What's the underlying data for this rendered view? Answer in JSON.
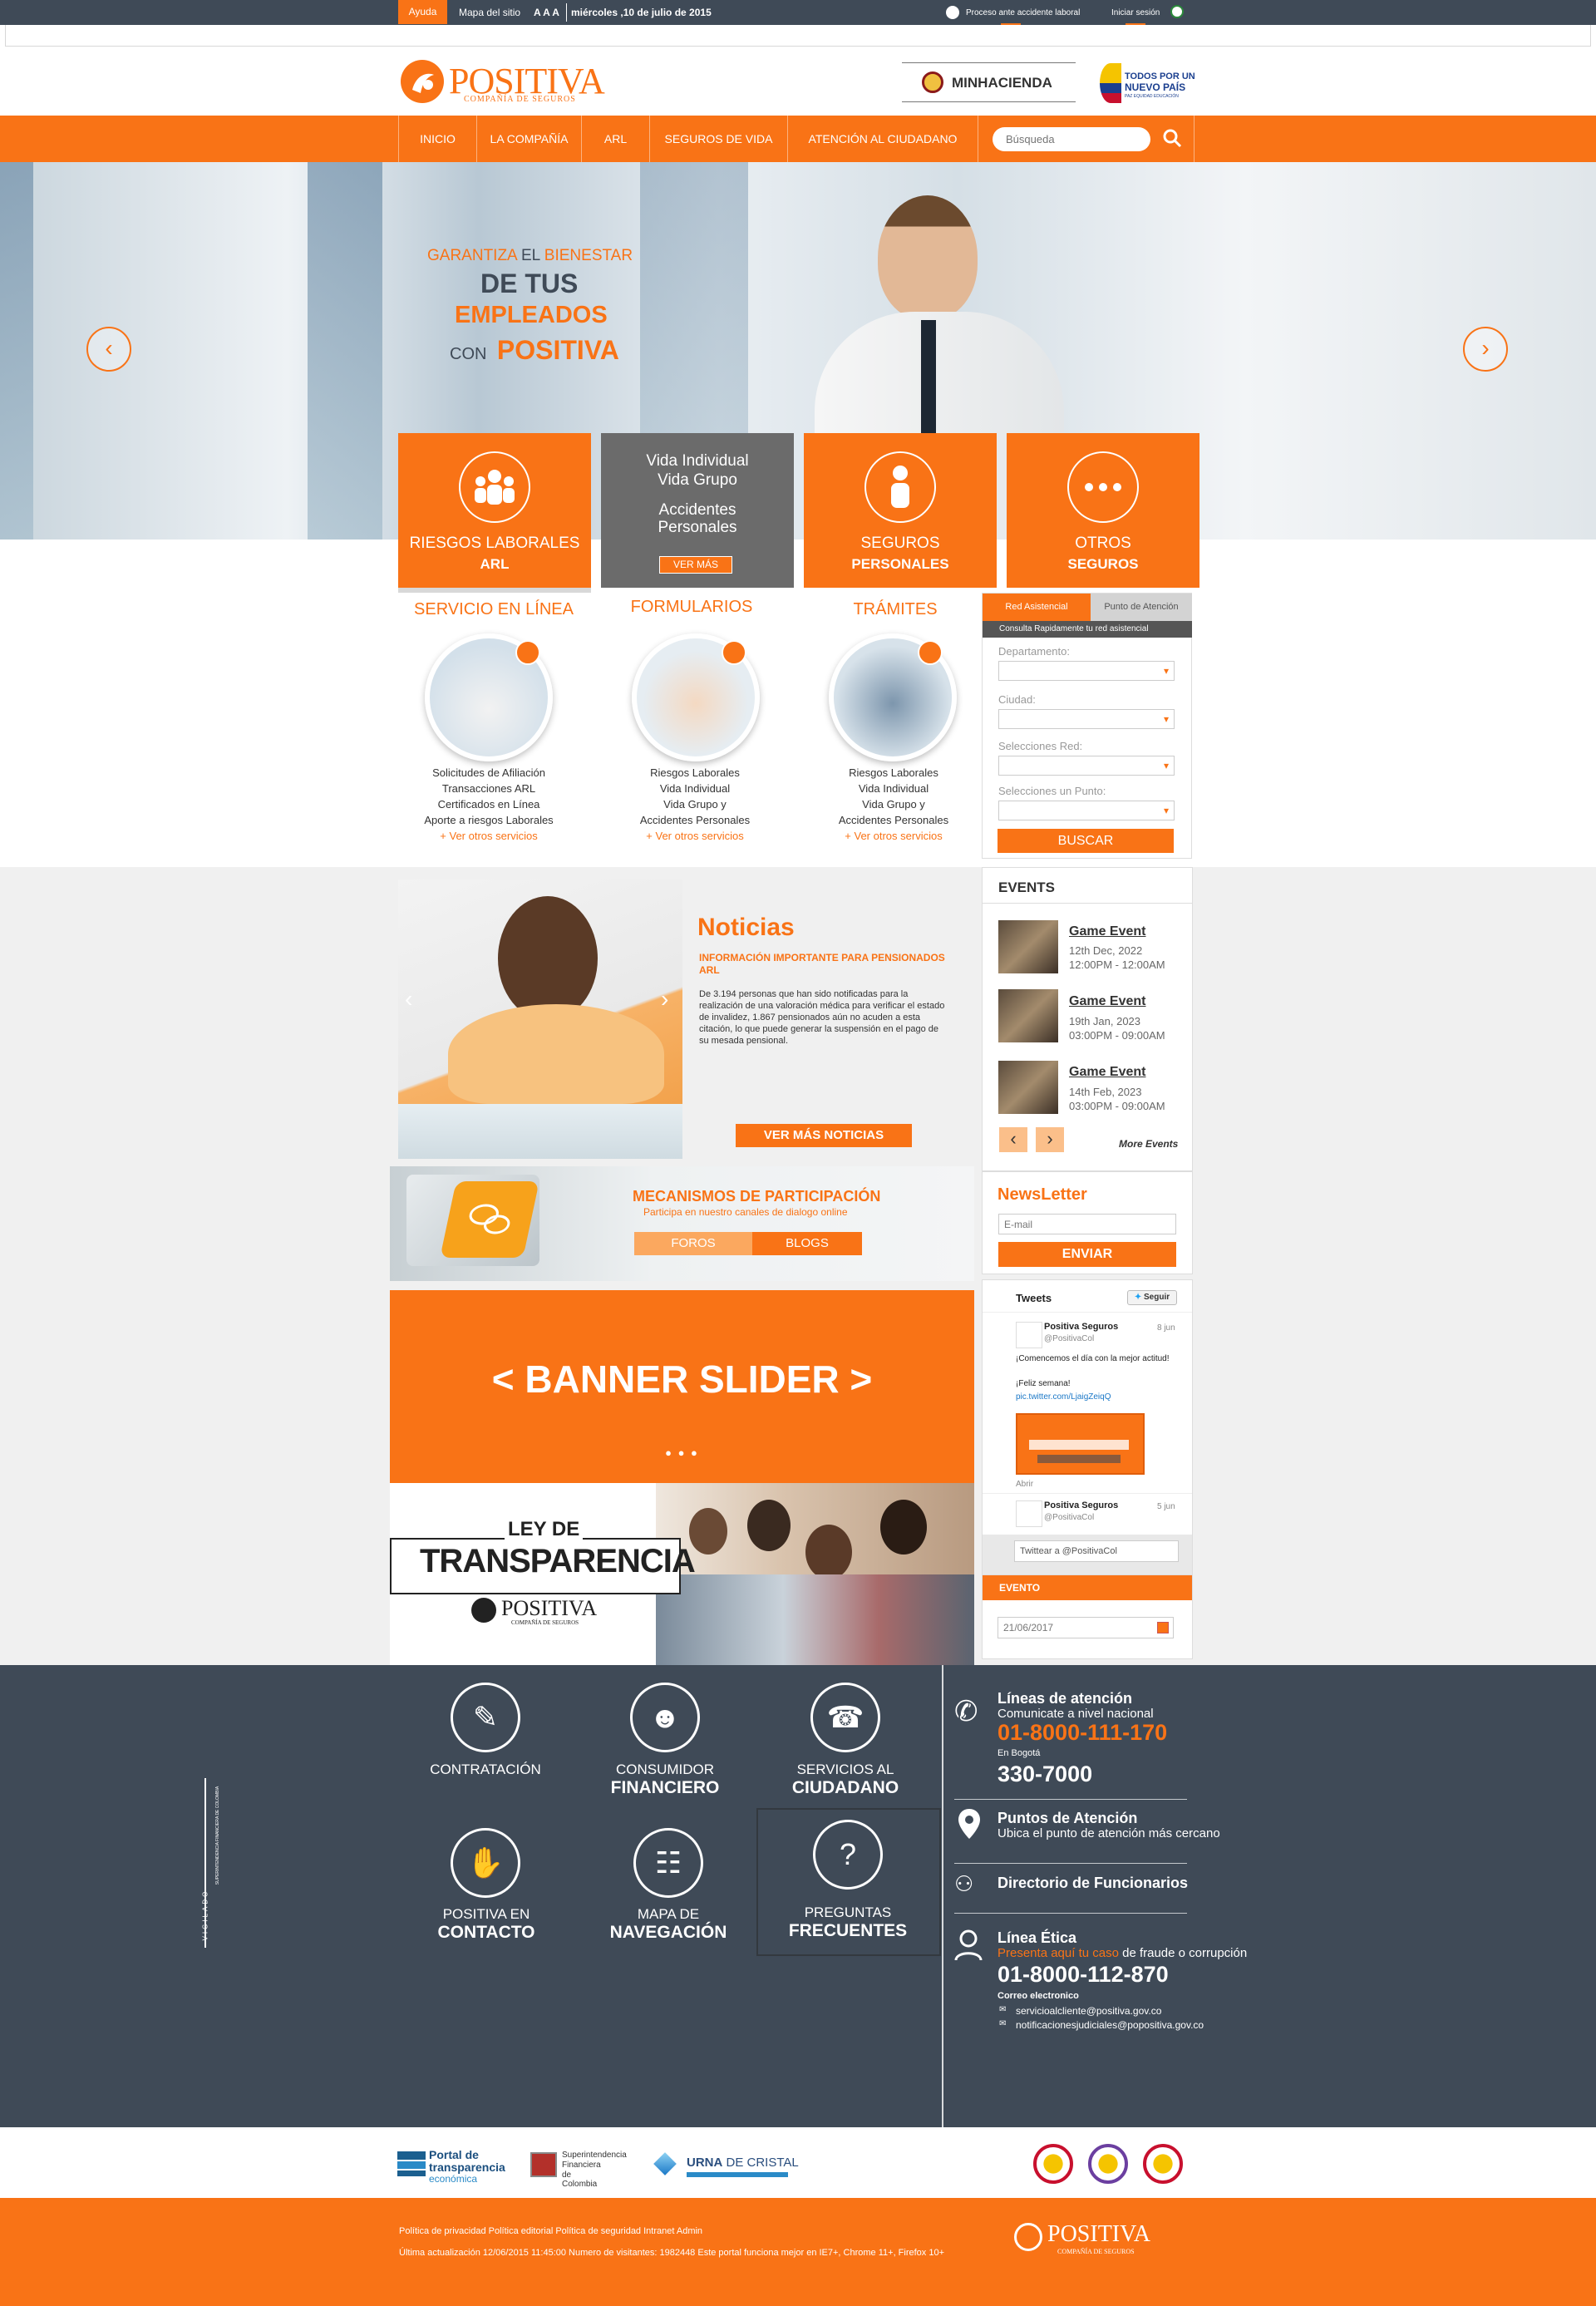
{
  "topbar": {
    "help": "Ayuda",
    "sitemap": "Mapa del sitio",
    "font_size": "A A A",
    "date": "miércoles ,10 de julio de 2015",
    "accident": "Proceso ante accidente laboral",
    "login": "Iniciar sesión"
  },
  "header": {
    "brand": "POSITIVA",
    "brand_sub": "COMPAÑÍA DE SEGUROS",
    "minhacienda": "MINHACIENDA",
    "gov_line1": "TODOS POR UN",
    "gov_line2": "NUEVO PAÍS",
    "gov_line3": "PAZ  EQUIDAD  EDUCACIÓN"
  },
  "nav": {
    "items": [
      "INICIO",
      "LA COMPAÑÍA",
      "ARL",
      "SEGUROS DE VIDA",
      "ATENCIÓN AL CIUDADANO"
    ],
    "search_placeholder": "Búsqueda"
  },
  "hero": {
    "line1a": "GARANTIZA",
    "line1b": "EL",
    "line1c": "BIENESTAR",
    "line2": "DE TUS",
    "line3": "EMPLEADOS",
    "line4a": "CON",
    "line4b": "POSITIVA"
  },
  "boxes": [
    {
      "l1": "RIESGOS LABORALES",
      "l2": "ARL"
    },
    {
      "l1": "Vida Individual",
      "l2": "Vida Grupo",
      "l3": "Accidentes",
      "l4": "Personales",
      "more": "VER MÁS"
    },
    {
      "l1": "SEGUROS",
      "l2": "PERSONALES"
    },
    {
      "l1": "OTROS",
      "l2": "SEGUROS"
    }
  ],
  "services": [
    {
      "title": "SERVICIO EN LÍNEA",
      "items": [
        "Solicitudes de Afiliación",
        "Transacciones ARL",
        "Certificados en Línea",
        "Aporte a riesgos Laborales"
      ],
      "more": "+ Ver otros servicios"
    },
    {
      "title": "FORMULARIOS",
      "items": [
        "Riesgos Laborales",
        "Vida Individual",
        "Vida Grupo y",
        "Accidentes Personales"
      ],
      "more": "+ Ver otros servicios"
    },
    {
      "title": "TRÁMITES",
      "items": [
        "Riesgos Laborales",
        "Vida Individual",
        "Vida Grupo y",
        "Accidentes Personales"
      ],
      "more": "+ Ver otros servicios"
    }
  ],
  "red_form": {
    "tab1": "Red Asistencial",
    "tab2": "Punto de Atención",
    "subtitle": "Consulta Rapidamente tu red asistencial",
    "fields": [
      "Departamento:",
      "Ciudad:",
      "Selecciones Red:",
      "Selecciones un Punto:"
    ],
    "button": "BUSCAR"
  },
  "news": {
    "title": "Noticias",
    "headline": "INFORMACIÓN IMPORTANTE PARA PENSIONADOS ARL",
    "body": "De 3.194 personas que han sido notificadas para la realización de una valoración médica para verificar el estado de invalidez, 1.867 pensionados aún no acuden a esta citación, lo que puede generar la suspensión en el pago de su mesada pensional.",
    "button": "VER MÁS NOTICIAS"
  },
  "events": {
    "title": "EVENTS",
    "items": [
      {
        "title": "Game Event",
        "date": "12th Dec, 2022",
        "time": "12:00PM - 12:00AM"
      },
      {
        "title": "Game Event",
        "date": "19th Jan, 2023",
        "time": "03:00PM - 09:00AM"
      },
      {
        "title": "Game Event",
        "date": "14th Feb, 2023",
        "time": "03:00PM - 09:00AM"
      }
    ],
    "more": "More Events"
  },
  "participation": {
    "title": "MECANISMOS DE PARTICIPACIÓN",
    "subtitle": "Participa en nuestro canales de dialogo online",
    "tab1": "FOROS",
    "tab2": "BLOGS"
  },
  "newsletter": {
    "title": "NewsLetter",
    "placeholder": "E-mail",
    "button": "ENVIAR"
  },
  "banner": {
    "text": "< BANNER SLIDER >",
    "dots": "● ● ●"
  },
  "tweets": {
    "title": "Tweets",
    "follow": "Seguir",
    "user": "Positiva Seguros",
    "handle": "@PositivaCol",
    "date1": "8 jun",
    "text1": "¡Comencemos el día con la mejor actitud!",
    "text2": "¡Feliz semana!",
    "link": "pic.twitter.com/LjaigZeiqQ",
    "open": "Abrir",
    "date2": "5 jun",
    "compose": "Twittear a @PositivaCol"
  },
  "evento": {
    "title": "EVENTO",
    "date": "21/06/2017"
  },
  "transparency": {
    "line1": "LEY DE",
    "line2": "TRANSPARENCIA"
  },
  "footer": {
    "links": [
      {
        "a": "CONTRATACIÓN",
        "b": ""
      },
      {
        "a": "CONSUMIDOR",
        "b": "FINANCIERO"
      },
      {
        "a": "SERVICIOS AL",
        "b": "CIUDADANO"
      },
      {
        "a": "POSITIVA EN",
        "b": "CONTACTO"
      },
      {
        "a": "MAPA DE",
        "b": "NAVEGACIÓN"
      },
      {
        "a": "PREGUNTAS",
        "b": "FRECUENTES"
      }
    ],
    "vigilado": "VIGILADO",
    "superintendencia": "SUPERINTENDENCIA FINANCIERA DE COLOMBIA",
    "lines_title": "Líneas de atención",
    "lines_sub": "Comunicate a nivel nacional",
    "lines_number": "01-8000-111-170",
    "bogota": "En Bogotá",
    "bogota_number": "330-7000",
    "points_title": "Puntos de Atención",
    "points_sub": "Ubica el punto de atención más cercano",
    "directory": "Directorio de Funcionarios",
    "ethics_title": "Línea Ética",
    "ethics_sub_a": "Presenta aquí tu caso",
    "ethics_sub_b": " de fraude o corrupción",
    "ethics_number": "01-8000-112-870",
    "email_label": "Correo electronico",
    "email1": "servicioalcliente@positiva.gov.co",
    "email2": "notificacionesjudiciales@popositiva.gov.co"
  },
  "partners": {
    "p1a": "Portal de",
    "p1b": "transparencia",
    "p1c": "económica",
    "p2a": "Superintendencia",
    "p2b": "Financiera",
    "p2c": "de Colombia",
    "p3a": "URNA",
    "p3b": " DE CRISTAL"
  },
  "bottom": {
    "links": "Política de privacidad Política editorial  Política de seguridad  Intranet Admin",
    "info": "Última actualización  12/06/2015 11:45:00  Numero de visitantes: 1982448  Este portal funciona mejor en IE7+, Chrome 11+, Firefox 10+",
    "brand": "POSITIVA",
    "brand_sub": "COMPAÑÍA DE SEGUROS"
  },
  "colors": {
    "accent": "#f97316",
    "dark": "#3f4a57"
  }
}
